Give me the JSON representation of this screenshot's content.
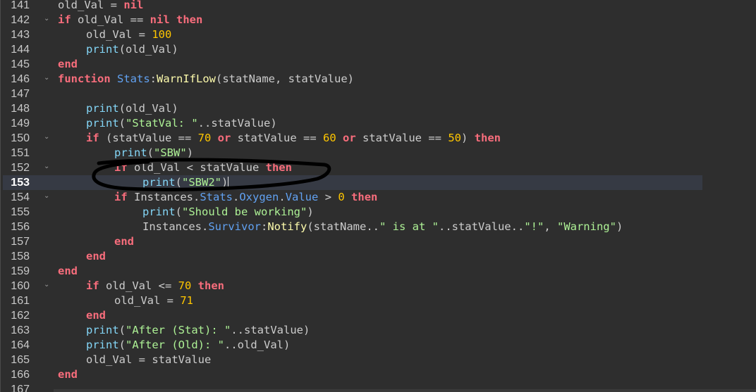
{
  "editor": {
    "current_line": "153",
    "lines": [
      {
        "n": "141",
        "fold": false,
        "indent": 0,
        "tokens": [
          [
            "plain",
            "old_Val = "
          ],
          [
            "kw",
            "nil"
          ]
        ]
      },
      {
        "n": "142",
        "fold": true,
        "indent": 0,
        "tokens": [
          [
            "kw",
            "if"
          ],
          [
            "plain",
            " old_Val == "
          ],
          [
            "kw",
            "nil"
          ],
          [
            "plain",
            " "
          ],
          [
            "kw",
            "then"
          ]
        ]
      },
      {
        "n": "143",
        "fold": false,
        "indent": 1,
        "tokens": [
          [
            "plain",
            "old_Val = "
          ],
          [
            "num",
            "100"
          ]
        ]
      },
      {
        "n": "144",
        "fold": false,
        "indent": 1,
        "tokens": [
          [
            "fn",
            "print"
          ],
          [
            "plain",
            "(old_Val)"
          ]
        ]
      },
      {
        "n": "145",
        "fold": false,
        "indent": 0,
        "tokens": [
          [
            "kw",
            "end"
          ]
        ]
      },
      {
        "n": "146",
        "fold": true,
        "indent": 0,
        "tokens": [
          [
            "kw",
            "function"
          ],
          [
            "plain",
            " "
          ],
          [
            "mem",
            "Stats"
          ],
          [
            "plain",
            ":"
          ],
          [
            "meth",
            "WarnIfLow"
          ],
          [
            "plain",
            "(statName, statValue)"
          ]
        ]
      },
      {
        "n": "147",
        "fold": false,
        "indent": 0,
        "tokens": []
      },
      {
        "n": "148",
        "fold": false,
        "indent": 1,
        "tokens": [
          [
            "fn",
            "print"
          ],
          [
            "plain",
            "(old_Val)"
          ]
        ]
      },
      {
        "n": "149",
        "fold": false,
        "indent": 1,
        "tokens": [
          [
            "fn",
            "print"
          ],
          [
            "plain",
            "("
          ],
          [
            "str",
            "\"StatVal: \""
          ],
          [
            "plain",
            "..statValue)"
          ]
        ]
      },
      {
        "n": "150",
        "fold": true,
        "indent": 1,
        "tokens": [
          [
            "kw",
            "if"
          ],
          [
            "plain",
            " (statValue == "
          ],
          [
            "num",
            "70"
          ],
          [
            "plain",
            " "
          ],
          [
            "kw",
            "or"
          ],
          [
            "plain",
            " statValue == "
          ],
          [
            "num",
            "60"
          ],
          [
            "plain",
            " "
          ],
          [
            "kw",
            "or"
          ],
          [
            "plain",
            " statValue == "
          ],
          [
            "num",
            "50"
          ],
          [
            "plain",
            ") "
          ],
          [
            "kw",
            "then"
          ]
        ]
      },
      {
        "n": "151",
        "fold": false,
        "indent": 2,
        "tokens": [
          [
            "fn",
            "print"
          ],
          [
            "plain",
            "("
          ],
          [
            "str",
            "\"SBW\""
          ],
          [
            "plain",
            ")"
          ]
        ]
      },
      {
        "n": "152",
        "fold": true,
        "indent": 2,
        "tokens": [
          [
            "kw",
            "if"
          ],
          [
            "plain",
            " old_Val < statValue "
          ],
          [
            "kw",
            "then"
          ]
        ]
      },
      {
        "n": "153",
        "fold": false,
        "indent": 3,
        "tokens": [
          [
            "fn",
            "print"
          ],
          [
            "plain",
            "("
          ],
          [
            "str",
            "\"SBW2\""
          ],
          [
            "plain",
            ")"
          ]
        ],
        "caret": true
      },
      {
        "n": "154",
        "fold": true,
        "indent": 2,
        "tokens": [
          [
            "kw",
            "if"
          ],
          [
            "plain",
            " Instances."
          ],
          [
            "mem",
            "Stats"
          ],
          [
            "plain",
            "."
          ],
          [
            "mem",
            "Oxygen"
          ],
          [
            "plain",
            "."
          ],
          [
            "mem",
            "Value"
          ],
          [
            "plain",
            " > "
          ],
          [
            "num",
            "0"
          ],
          [
            "plain",
            " "
          ],
          [
            "kw",
            "then"
          ]
        ]
      },
      {
        "n": "155",
        "fold": false,
        "indent": 3,
        "tokens": [
          [
            "fn",
            "print"
          ],
          [
            "plain",
            "("
          ],
          [
            "str",
            "\"Should be working\""
          ],
          [
            "plain",
            ")"
          ]
        ]
      },
      {
        "n": "156",
        "fold": false,
        "indent": 3,
        "tokens": [
          [
            "plain",
            "Instances."
          ],
          [
            "mem",
            "Survivor"
          ],
          [
            "plain",
            ":"
          ],
          [
            "meth",
            "Notify"
          ],
          [
            "plain",
            "(statName.."
          ],
          [
            "str",
            "\" is at \""
          ],
          [
            "plain",
            "..statValue.."
          ],
          [
            "str",
            "\"!\""
          ],
          [
            "plain",
            ", "
          ],
          [
            "str",
            "\"Warning\""
          ],
          [
            "plain",
            ")"
          ]
        ]
      },
      {
        "n": "157",
        "fold": false,
        "indent": 2,
        "tokens": [
          [
            "kw",
            "end"
          ]
        ]
      },
      {
        "n": "158",
        "fold": false,
        "indent": 1,
        "tokens": [
          [
            "kw",
            "end"
          ]
        ]
      },
      {
        "n": "159",
        "fold": false,
        "indent": 0,
        "tokens": [
          [
            "kw",
            "end"
          ]
        ]
      },
      {
        "n": "160",
        "fold": true,
        "indent": 1,
        "tokens": [
          [
            "kw",
            "if"
          ],
          [
            "plain",
            " old_Val <= "
          ],
          [
            "num",
            "70"
          ],
          [
            "plain",
            " "
          ],
          [
            "kw",
            "then"
          ]
        ]
      },
      {
        "n": "161",
        "fold": false,
        "indent": 2,
        "tokens": [
          [
            "plain",
            "old_Val = "
          ],
          [
            "num",
            "71"
          ]
        ]
      },
      {
        "n": "162",
        "fold": false,
        "indent": 1,
        "tokens": [
          [
            "kw",
            "end"
          ]
        ]
      },
      {
        "n": "163",
        "fold": false,
        "indent": 1,
        "tokens": [
          [
            "fn",
            "print"
          ],
          [
            "plain",
            "("
          ],
          [
            "str",
            "\"After (Stat): \""
          ],
          [
            "plain",
            "..statValue)"
          ]
        ]
      },
      {
        "n": "164",
        "fold": false,
        "indent": 1,
        "tokens": [
          [
            "fn",
            "print"
          ],
          [
            "plain",
            "("
          ],
          [
            "str",
            "\"After (Old): \""
          ],
          [
            "plain",
            "..old_Val)"
          ]
        ]
      },
      {
        "n": "165",
        "fold": false,
        "indent": 1,
        "tokens": [
          [
            "plain",
            "old_Val = statValue"
          ]
        ]
      },
      {
        "n": "166",
        "fold": false,
        "indent": 0,
        "tokens": [
          [
            "kw",
            "end"
          ]
        ]
      },
      {
        "n": "167",
        "fold": false,
        "indent": 0,
        "tokens": []
      }
    ],
    "fold_glyph": "⌄"
  },
  "colors": {
    "background": "#2e2e2e",
    "keyword": "#f86d7c",
    "builtin": "#84d6f7",
    "number": "#ffc600",
    "string": "#adf195",
    "member": "#61a1f1",
    "method": "#fdfbac",
    "text": "#cccccc",
    "annotation": "#000000"
  }
}
